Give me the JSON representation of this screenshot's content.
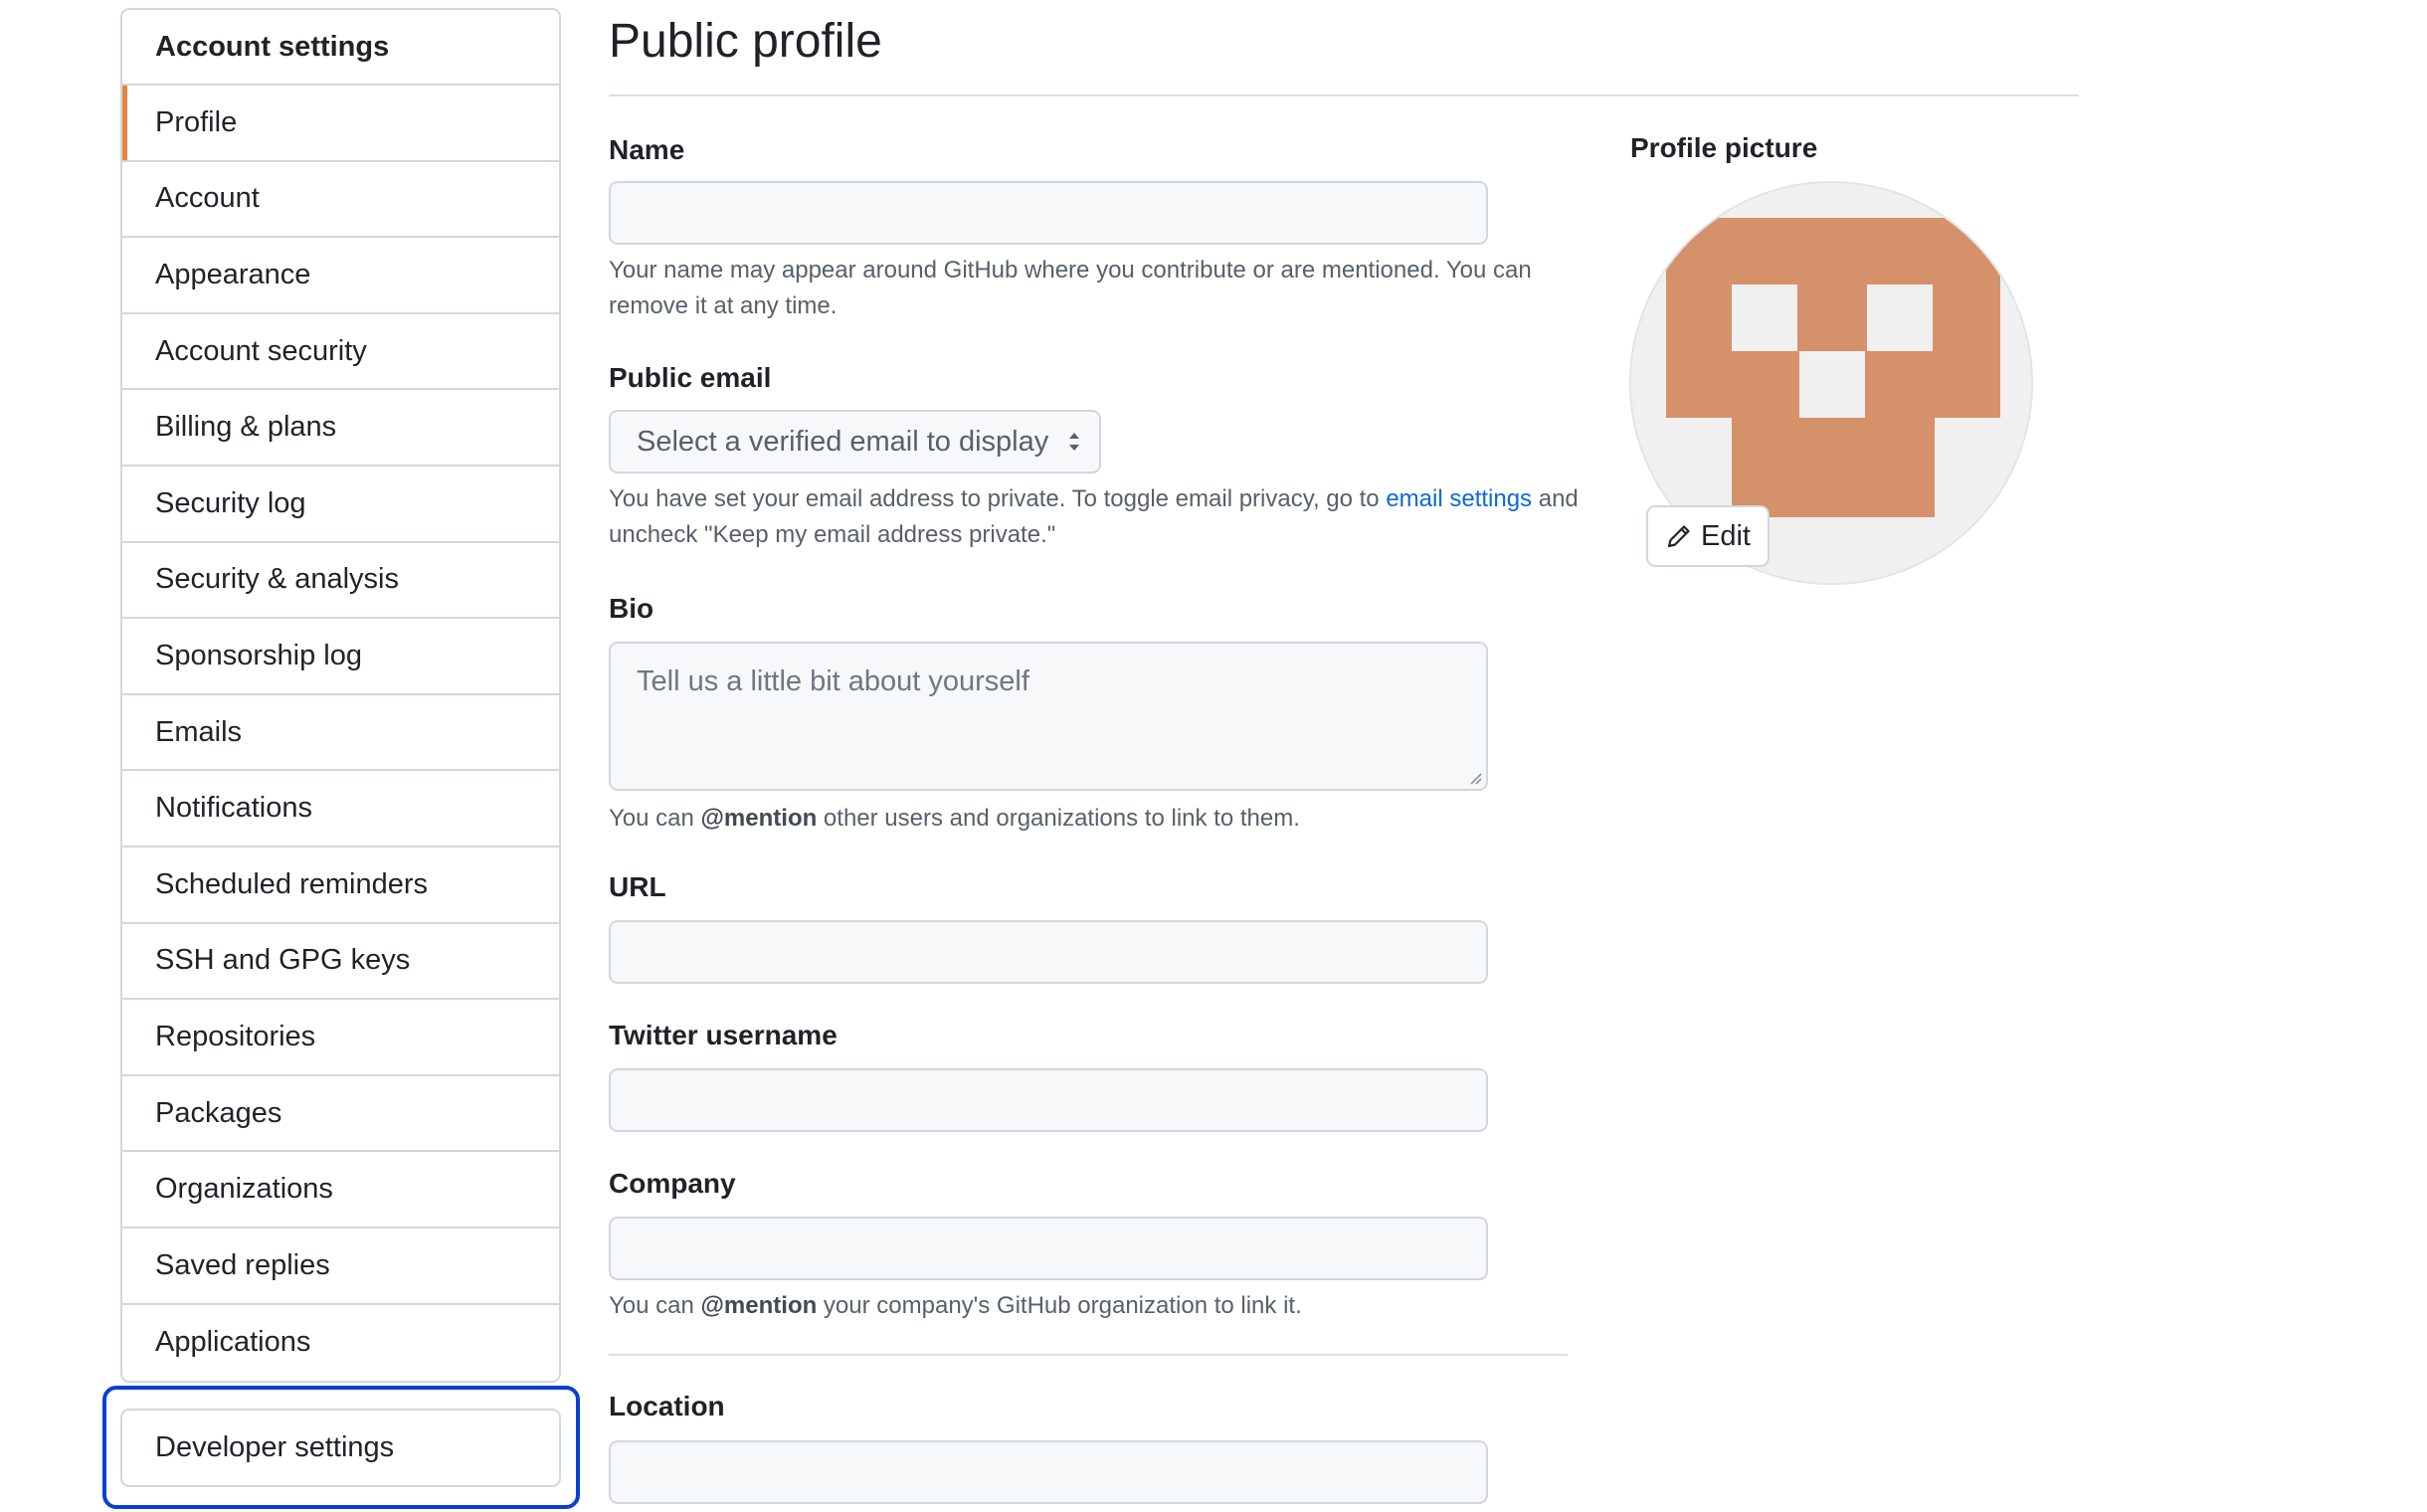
{
  "sidebar": {
    "heading": "Account settings",
    "items": [
      {
        "label": "Profile",
        "name": "sidebar-item-profile",
        "active": true
      },
      {
        "label": "Account",
        "name": "sidebar-item-account"
      },
      {
        "label": "Appearance",
        "name": "sidebar-item-appearance"
      },
      {
        "label": "Account security",
        "name": "sidebar-item-account-security"
      },
      {
        "label": "Billing & plans",
        "name": "sidebar-item-billing-plans"
      },
      {
        "label": "Security log",
        "name": "sidebar-item-security-log"
      },
      {
        "label": "Security & analysis",
        "name": "sidebar-item-security-analysis"
      },
      {
        "label": "Sponsorship log",
        "name": "sidebar-item-sponsorship-log"
      },
      {
        "label": "Emails",
        "name": "sidebar-item-emails"
      },
      {
        "label": "Notifications",
        "name": "sidebar-item-notifications"
      },
      {
        "label": "Scheduled reminders",
        "name": "sidebar-item-scheduled-reminders"
      },
      {
        "label": "SSH and GPG keys",
        "name": "sidebar-item-ssh-gpg-keys"
      },
      {
        "label": "Repositories",
        "name": "sidebar-item-repositories"
      },
      {
        "label": "Packages",
        "name": "sidebar-item-packages"
      },
      {
        "label": "Organizations",
        "name": "sidebar-item-organizations"
      },
      {
        "label": "Saved replies",
        "name": "sidebar-item-saved-replies"
      },
      {
        "label": "Applications",
        "name": "sidebar-item-applications"
      }
    ],
    "developer_settings": "Developer settings"
  },
  "page": {
    "title": "Public profile"
  },
  "form": {
    "name": {
      "label": "Name",
      "value": "",
      "note": "Your name may appear around GitHub where you contribute or are mentioned. You can remove it at any time."
    },
    "public_email": {
      "label": "Public email",
      "selected": "Select a verified email to display",
      "note_before": "You have set your email address to private. To toggle email privacy, go to ",
      "note_link": "email settings",
      "note_after": " and uncheck \"Keep my email address private.\""
    },
    "bio": {
      "label": "Bio",
      "placeholder": "Tell us a little bit about yourself",
      "note_before": "You can ",
      "note_mention": "@mention",
      "note_after": " other users and organizations to link to them."
    },
    "url": {
      "label": "URL",
      "value": ""
    },
    "twitter": {
      "label": "Twitter username",
      "value": ""
    },
    "company": {
      "label": "Company",
      "value": "",
      "note_before": "You can ",
      "note_mention": "@mention",
      "note_after": " your company's GitHub organization to link it."
    },
    "location": {
      "label": "Location",
      "value": ""
    }
  },
  "profile_picture": {
    "label": "Profile picture",
    "edit_label": "Edit",
    "edit_icon": "pencil-icon"
  },
  "colors": {
    "accent_active": "#e16f24",
    "avatar_fill": "#d4916a",
    "avatar_background": "#f0f0f0",
    "highlight_border": "#0a3fd6",
    "link": "#0969da"
  }
}
